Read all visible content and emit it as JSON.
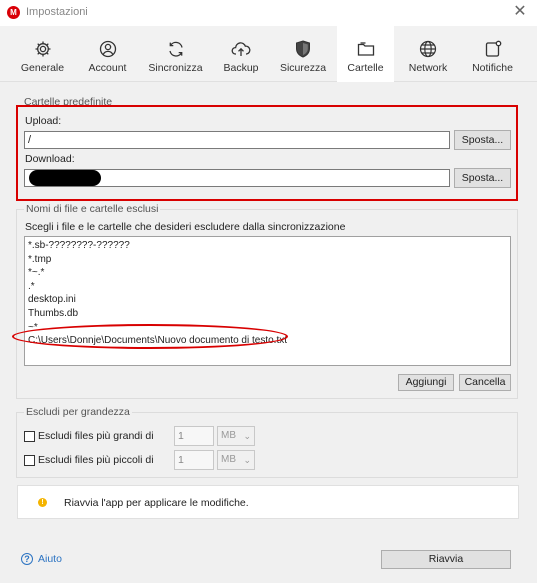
{
  "window": {
    "title": "Impostazioni",
    "app_icon": "M"
  },
  "tabs": [
    {
      "label": "Generale",
      "icon": "gear-icon"
    },
    {
      "label": "Account",
      "icon": "account-icon"
    },
    {
      "label": "Sincronizza",
      "icon": "sync-icon"
    },
    {
      "label": "Backup",
      "icon": "cloud-upload-icon"
    },
    {
      "label": "Sicurezza",
      "icon": "shield-icon"
    },
    {
      "label": "Cartelle",
      "icon": "folder-icon",
      "active": true
    },
    {
      "label": "Network",
      "icon": "globe-icon"
    },
    {
      "label": "Notifiche",
      "icon": "bell-icon"
    }
  ],
  "default_folders": {
    "title": "Cartelle predefinite",
    "upload_label": "Upload:",
    "upload_value": "/",
    "download_label": "Download:",
    "download_value": "",
    "move_label": "Sposta..."
  },
  "exclusions": {
    "title": "Nomi di file e cartelle esclusi",
    "description": "Scegli i file e le cartelle che desideri escludere dalla sincronizzazione",
    "items": [
      "*.sb-????????-??????",
      "*.tmp",
      "*~.*",
      ".*",
      "desktop.ini",
      "Thumbs.db",
      "~*",
      "C:\\Users\\Donnje\\Documents\\Nuovo documento di testo.txt"
    ],
    "add_label": "Aggiungi",
    "cancel_label": "Cancella"
  },
  "size_exclusion": {
    "title": "Escludi per grandezza",
    "larger_label": "Escludi files più grandi di",
    "larger_value": "1",
    "larger_unit": "MB",
    "smaller_label": "Escludi files più piccoli di",
    "smaller_value": "1",
    "smaller_unit": "MB"
  },
  "notice": {
    "text": "Riavvia l'app per applicare le modifiche."
  },
  "footer": {
    "help_label": "Aiuto",
    "restart_label": "Riavvia"
  },
  "colors": {
    "annotation_red": "#d80000",
    "link_blue": "#2b73c2",
    "brand_red": "#d90007",
    "warning": "#f4b400"
  }
}
